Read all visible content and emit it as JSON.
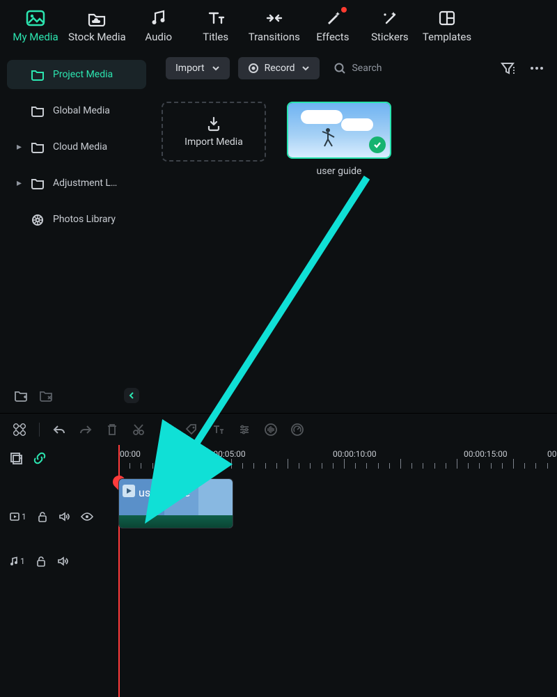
{
  "nav": {
    "items": [
      {
        "label": "My Media"
      },
      {
        "label": "Stock Media"
      },
      {
        "label": "Audio"
      },
      {
        "label": "Titles"
      },
      {
        "label": "Transitions"
      },
      {
        "label": "Effects"
      },
      {
        "label": "Stickers"
      },
      {
        "label": "Templates"
      }
    ]
  },
  "sidebar": {
    "items": [
      {
        "label": "Project Media"
      },
      {
        "label": "Global Media"
      },
      {
        "label": "Cloud Media"
      },
      {
        "label": "Adjustment L…"
      },
      {
        "label": "Photos Library"
      }
    ]
  },
  "toolbar": {
    "import": "Import",
    "record": "Record"
  },
  "search": {
    "placeholder": "Search"
  },
  "media": {
    "import_card": "Import Media",
    "clip_name": "user guide"
  },
  "timeline": {
    "marks": [
      "00:00",
      "00:00:05:00",
      "00:00:10:00",
      "00:00:15:00",
      "00:"
    ],
    "clip_label": "user guide",
    "video_track": "1",
    "audio_track": "1"
  }
}
